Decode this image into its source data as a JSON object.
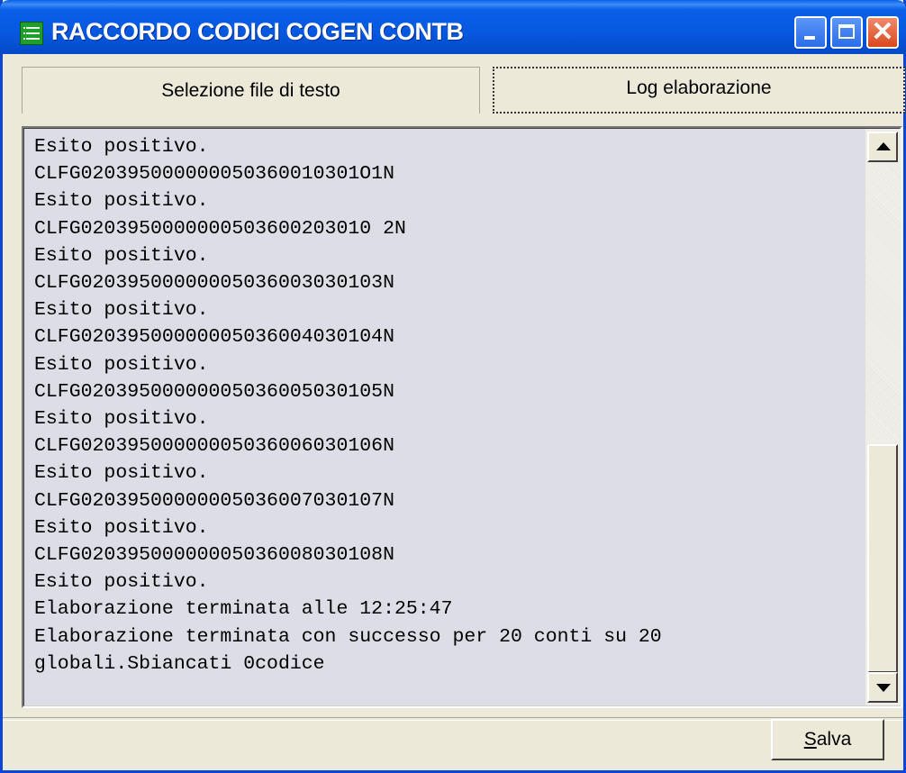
{
  "window": {
    "title": "RACCORDO CODICI COGEN CONTB"
  },
  "tabs": [
    {
      "label": "Selezione file di testo"
    },
    {
      "label": "Log elaborazione"
    }
  ],
  "log_lines": [
    "Esito positivo.",
    "CLFG020395000000050360010301O1N",
    "Esito positivo.",
    "CLFG0203950000000503600203010 2N",
    "Esito positivo.",
    "CLFG02039500000005036003030103N",
    "Esito positivo.",
    "CLFG02039500000005036004030104N",
    "Esito positivo.",
    "CLFG02039500000005036005030105N",
    "Esito positivo.",
    "CLFG02039500000005036006030106N",
    "Esito positivo.",
    "CLFG02039500000005036007030107N",
    "Esito positivo.",
    "CLFG02039500000005036008030108N",
    "Esito positivo.",
    "Elaborazione terminata alle 12:25:47",
    "Elaborazione terminata con successo per 20 conti su 20",
    "globali.Sbiancati 0codice"
  ],
  "buttons": {
    "save_accesskey": "S",
    "save_rest": "alva"
  },
  "icons": {
    "app": "app-table-icon",
    "minimize": "minimize-icon",
    "maximize": "maximize-icon",
    "close": "close-icon",
    "scroll_up": "scroll-up-arrow-icon",
    "scroll_down": "scroll-down-arrow-icon"
  },
  "colors": {
    "titlebar": "#0a5fe8",
    "window_bg": "#ece9d8",
    "log_bg": "#dddde6",
    "close_button": "#d9481f"
  }
}
